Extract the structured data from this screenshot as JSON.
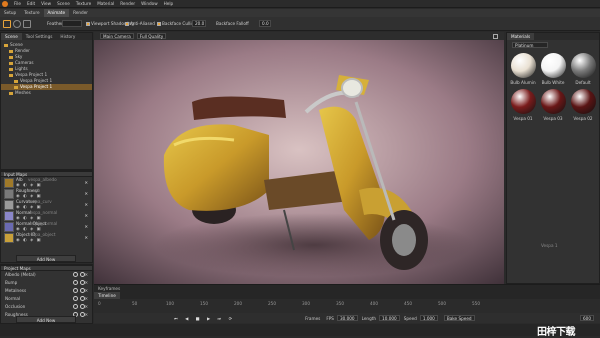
{
  "app": {
    "menu": [
      "File",
      "Edit",
      "View",
      "Scene",
      "Texture",
      "Material",
      "Render",
      "Window",
      "Help"
    ]
  },
  "modes": [
    "Setup",
    "Texture",
    "Animate",
    "Render"
  ],
  "toolbar": {
    "feather_label": "Feather",
    "viewport_shadowing": "Viewport Shadowing",
    "anti_aliased": "Anti-Aliased",
    "backface_culling": "Backface Culling",
    "value1": "20.0",
    "backface_falloff": "Backface Falloff",
    "value2": "0.0"
  },
  "left_tabs": [
    "Scene",
    "Tool Settings",
    "History"
  ],
  "tree": [
    {
      "label": "Scene",
      "indent": 0,
      "sel": false
    },
    {
      "label": "Render",
      "indent": 1,
      "sel": false
    },
    {
      "label": "Sky",
      "indent": 1,
      "sel": false
    },
    {
      "label": "Cameras",
      "indent": 1,
      "sel": false
    },
    {
      "label": "Lights",
      "indent": 1,
      "sel": false
    },
    {
      "label": "Vespa Project 1",
      "indent": 1,
      "sel": false
    },
    {
      "label": "Vespa Project 1",
      "indent": 2,
      "sel": false
    },
    {
      "label": "Vespa Project 1",
      "indent": 2,
      "sel": true
    },
    {
      "label": "Meshes",
      "indent": 1,
      "sel": false
    }
  ],
  "input_maps": {
    "header": "Input Maps",
    "rows": [
      {
        "label": "Alb",
        "value": "vespa_albedo",
        "color": "#a07a2a"
      },
      {
        "label": "Roughness",
        "value": "rough",
        "color": "#7a7a7a"
      },
      {
        "label": "Curvature",
        "value": "vespa_curv",
        "color": "#9a9a9a"
      },
      {
        "label": "Normal",
        "value": "vespa_normal",
        "color": "#8a86c8"
      },
      {
        "label": "Normal Object",
        "value": "vespa_normal",
        "color": "#6a6ab0"
      },
      {
        "label": "Object ID",
        "value": "vespa_object",
        "color": "#c8a03a"
      }
    ],
    "add_button": "Add New"
  },
  "project_maps": {
    "header": "Project Maps",
    "rows": [
      "Albedo (Metal)",
      "Bump",
      "Metalness",
      "Normal",
      "Occlusion",
      "Roughness"
    ],
    "add_button": "Add New"
  },
  "viewport": {
    "camera": "Main Camera",
    "quality": "Full Quality"
  },
  "materials": {
    "title": "Materials",
    "filter": "Platinum",
    "items": [
      {
        "label": "Bulb Alumin",
        "color": "#e9e0d2"
      },
      {
        "label": "Bulb White",
        "color": "#f4f4f4"
      },
      {
        "label": "Default",
        "color": "#7a7a7a"
      },
      {
        "label": "Vespa 01",
        "color": "#7a1c1c"
      },
      {
        "label": "Vespa 03",
        "color": "#6a1717"
      },
      {
        "label": "Vespa 02",
        "color": "#5a1414"
      }
    ],
    "side_text": "Vespa 1"
  },
  "bottom_tabs": [
    "Keyframes",
    "Timeline"
  ],
  "timeline": {
    "ticks": [
      "0",
      "50",
      "100",
      "150",
      "200",
      "250",
      "300",
      "350",
      "400",
      "450",
      "500",
      "550"
    ],
    "frames_label": "Frames",
    "fps_label": "FPS",
    "fps": "30.000",
    "length_label": "Length",
    "length": "10.000",
    "speed_label": "Speed",
    "speed": "1.000",
    "bake_btn": "Bake Speed",
    "frame": "600"
  },
  "watermark": "田梓下载"
}
